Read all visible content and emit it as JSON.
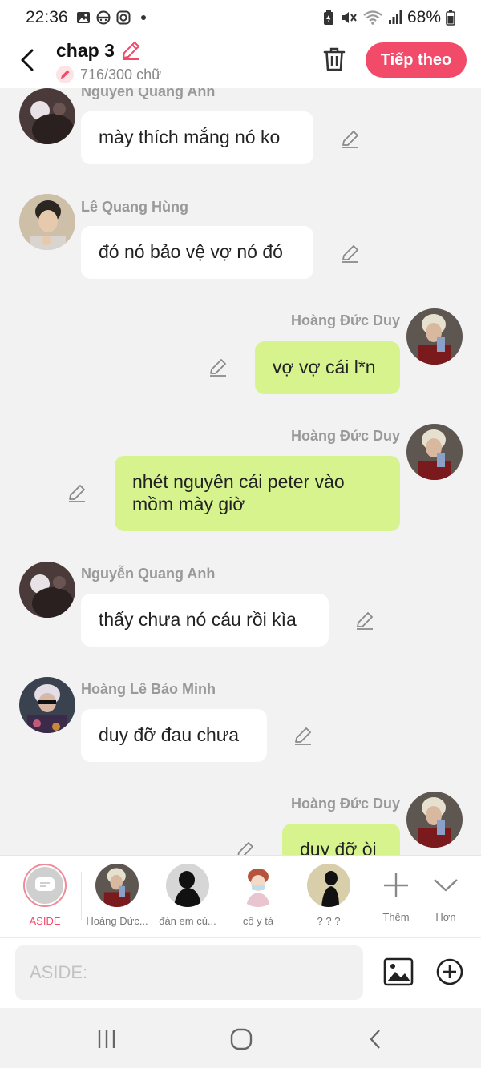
{
  "status": {
    "time": "22:36",
    "battery": "68%",
    "icons": [
      "image-icon",
      "no-face-icon",
      "instagram-icon",
      "dot-icon",
      "battery-saver-icon",
      "mute-icon",
      "wifi-icon",
      "signal-icon",
      "battery-icon"
    ]
  },
  "header": {
    "title": "chap 3",
    "word_count": "716/300 chữ",
    "next_label": "Tiếp theo"
  },
  "messages": [
    {
      "side": "left",
      "name": "Nguyen Quang Anh",
      "text": "mày thích mắng nó ko"
    },
    {
      "side": "left",
      "name": "Lê Quang Hùng",
      "text": "đó nó bảo vệ vợ nó đó"
    },
    {
      "side": "right",
      "name": "Hoàng Đức Duy",
      "text": "vợ vợ cái l*n"
    },
    {
      "side": "right",
      "name": "Hoàng Đức Duy",
      "text": "nhét nguyên cái peter vào mồm mày giờ"
    },
    {
      "side": "left",
      "name": "Nguyễn Quang Anh",
      "text": "thấy chưa nó cáu rồi kìa"
    },
    {
      "side": "left",
      "name": "Hoàng Lê Bảo Minh",
      "text": "duy đỡ đau chưa"
    },
    {
      "side": "right",
      "name": "Hoàng Đức Duy",
      "text": "duy đỡ òi"
    }
  ],
  "characters": [
    {
      "label": "ASIDE"
    },
    {
      "label": "Hoàng Đức..."
    },
    {
      "label": "đàn em củ..."
    },
    {
      "label": "cô y tá"
    },
    {
      "label": "? ? ?"
    },
    {
      "label": "Thêm"
    },
    {
      "label": "Hơn"
    }
  ],
  "input": {
    "placeholder": "ASIDE:"
  },
  "colors": {
    "accent": "#f24b6a",
    "right_bubble": "#d6f38e",
    "left_bubble": "#ffffff",
    "background": "#f2f2f2"
  }
}
